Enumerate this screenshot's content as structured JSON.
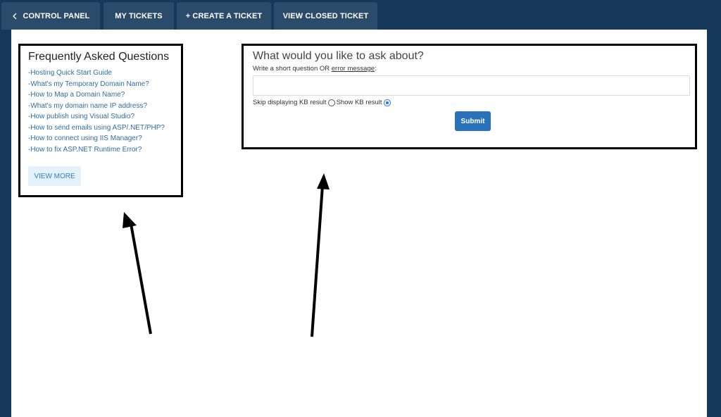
{
  "nav": {
    "tabs": [
      {
        "label": "CONTROL PANEL",
        "icon": "chevron-left-icon"
      },
      {
        "label": "MY TICKETS"
      },
      {
        "label": "+ CREATE A TICKET"
      },
      {
        "label": "VIEW CLOSED TICKET"
      }
    ]
  },
  "faq": {
    "title": "Frequently Asked Questions",
    "items": [
      "-Hosting Quick Start Guide",
      "-What's my Temporary Domain Name?",
      "-How to Map a Domain Name?",
      "-What's my domain name IP address?",
      "-How publish using Visual Studio?",
      "-How to send emails using ASP/.NET/PHP?",
      "-How to connect using IIS Manager?",
      "-How to fix ASP.NET Runtime Error?"
    ],
    "view_more": "VIEW MORE"
  },
  "ask": {
    "title": "What would you like to ask about?",
    "subtitle_prefix": "Write a short question OR ",
    "subtitle_link": "error message",
    "subtitle_suffix": ":",
    "input_value": "",
    "radio_skip": "Skip displaying KB result",
    "radio_show": "Show KB result",
    "selected": "show",
    "submit": "Submit"
  },
  "colors": {
    "nav_background": "#16385a",
    "tab_background": "#2b4b6a",
    "link": "#2e6da4",
    "submit": "#2a72b8"
  }
}
